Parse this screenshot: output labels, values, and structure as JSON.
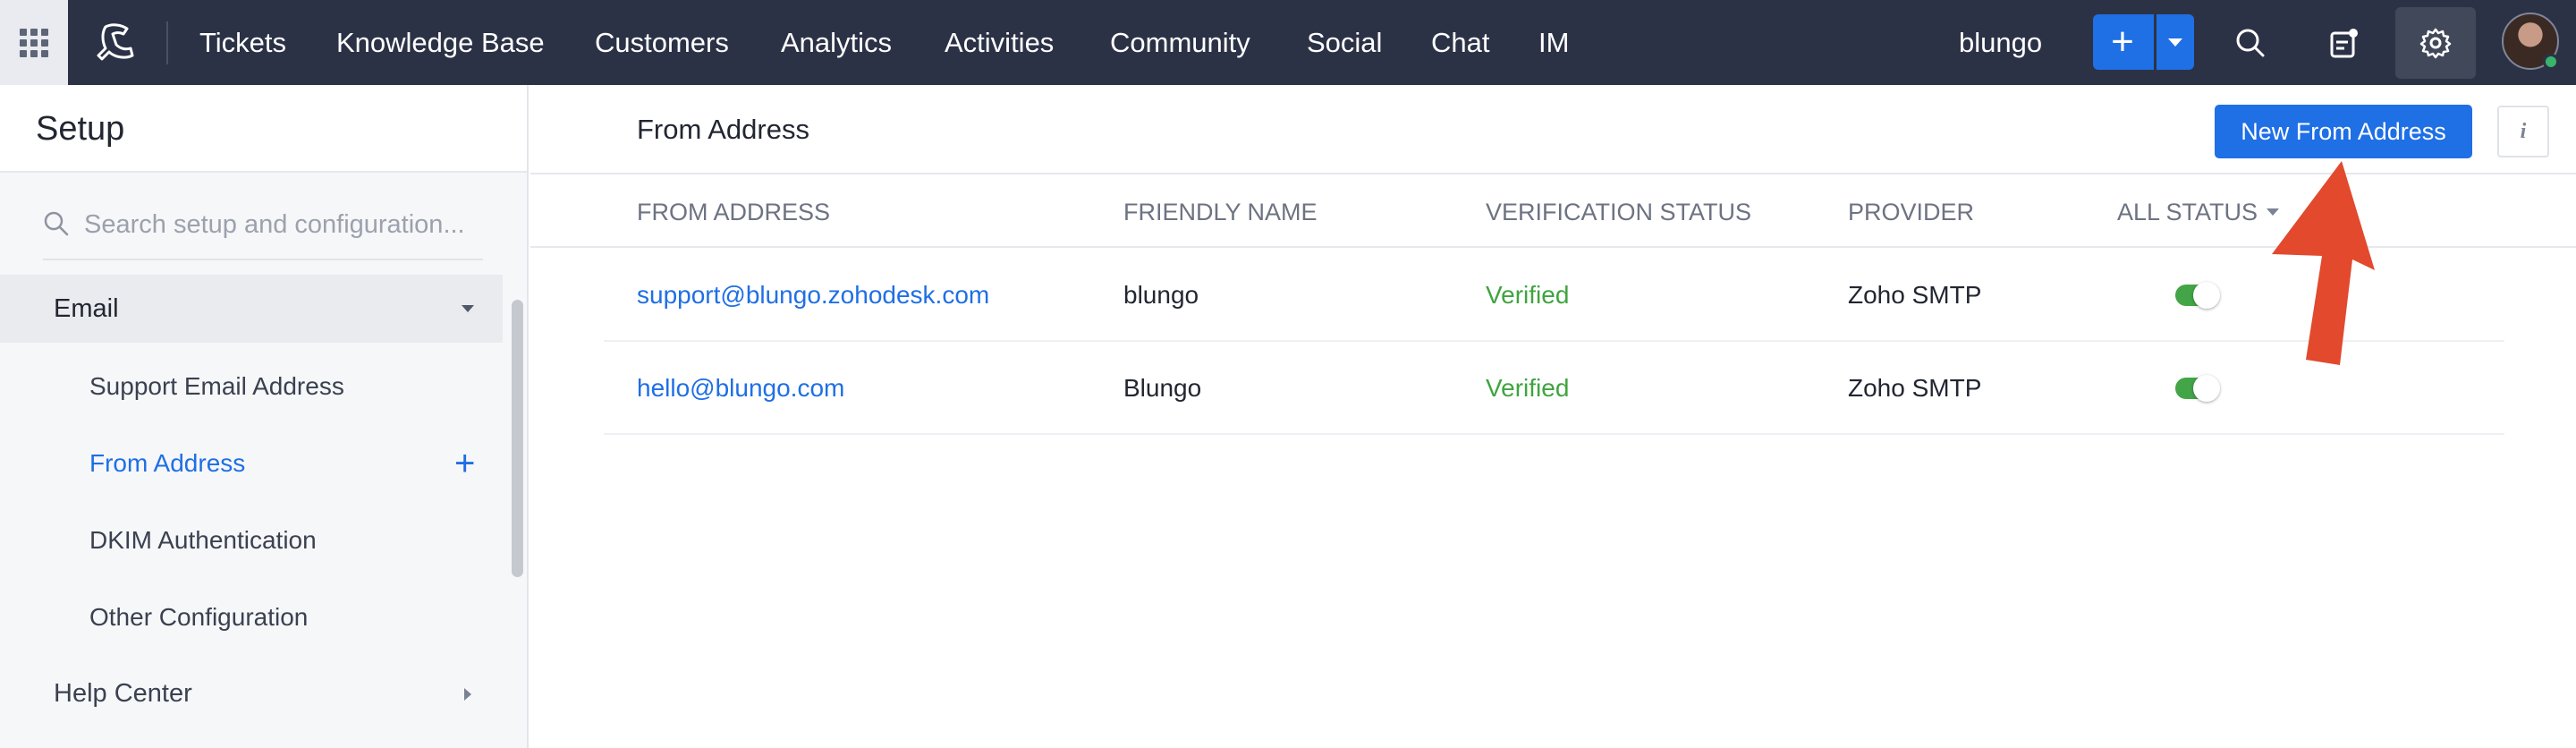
{
  "topnav": {
    "items": [
      "Tickets",
      "Knowledge Base",
      "Customers",
      "Analytics",
      "Activities",
      "Community",
      "Social",
      "Chat",
      "IM"
    ],
    "org_name": "blungo",
    "add_symbol": "+"
  },
  "sidebar": {
    "title": "Setup",
    "search_placeholder": "Search setup and configuration...",
    "section": "Email",
    "items": [
      "Support Email Address",
      "From Address",
      "DKIM Authentication",
      "Other Configuration"
    ],
    "active_item": "From Address",
    "help_center": "Help Center"
  },
  "main": {
    "title": "From Address",
    "new_button": "New From Address",
    "info_symbol": "i",
    "columns": {
      "from_address": "FROM ADDRESS",
      "friendly_name": "FRIENDLY NAME",
      "verification_status": "VERIFICATION STATUS",
      "provider": "PROVIDER",
      "status_filter": "ALL STATUS"
    },
    "rows": [
      {
        "email": "support@blungo.zohodesk.com",
        "name": "blungo",
        "status": "Verified",
        "provider": "Zoho SMTP",
        "enabled": true
      },
      {
        "email": "hello@blungo.com",
        "name": "Blungo",
        "status": "Verified",
        "provider": "Zoho SMTP",
        "enabled": true
      }
    ]
  },
  "colors": {
    "nav_bg": "#2c3246",
    "accent": "#1f6fe5",
    "verified": "#3fa43f",
    "toggle_on": "#43a547",
    "annotation_arrow": "#e2492d"
  },
  "icons": {
    "apps": "grid-icon",
    "logo": "desk-logo-icon",
    "search": "search-icon",
    "notes": "notes-icon",
    "settings": "gear-icon",
    "info": "info-icon"
  }
}
